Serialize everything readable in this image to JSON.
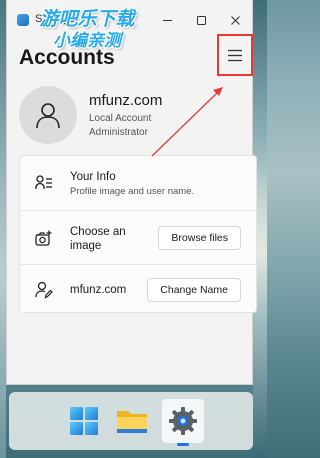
{
  "window": {
    "title": "Settings"
  },
  "watermark": {
    "line1": "游吧乐下载",
    "line2": "小编亲测"
  },
  "page": {
    "title": "Accounts"
  },
  "header": {
    "menu_icon": "hamburger-menu-icon"
  },
  "profile": {
    "name": "mfunz.com",
    "account_type": "Local Account",
    "role": "Administrator"
  },
  "settings": {
    "your_info": {
      "title": "Your Info",
      "subtitle": "Profile image and user name."
    },
    "choose_image": {
      "title": "Choose an image",
      "button": "Browse files"
    },
    "username": {
      "title": "mfunz.com",
      "button": "Change Name"
    }
  },
  "taskbar": {
    "items": [
      "windows-start-icon",
      "file-explorer-icon",
      "settings-gear-icon"
    ],
    "active": "settings-gear-icon"
  },
  "colors": {
    "annotation": "#e53935",
    "accent": "#1a73e8",
    "watermark": "#2aa9e8"
  }
}
